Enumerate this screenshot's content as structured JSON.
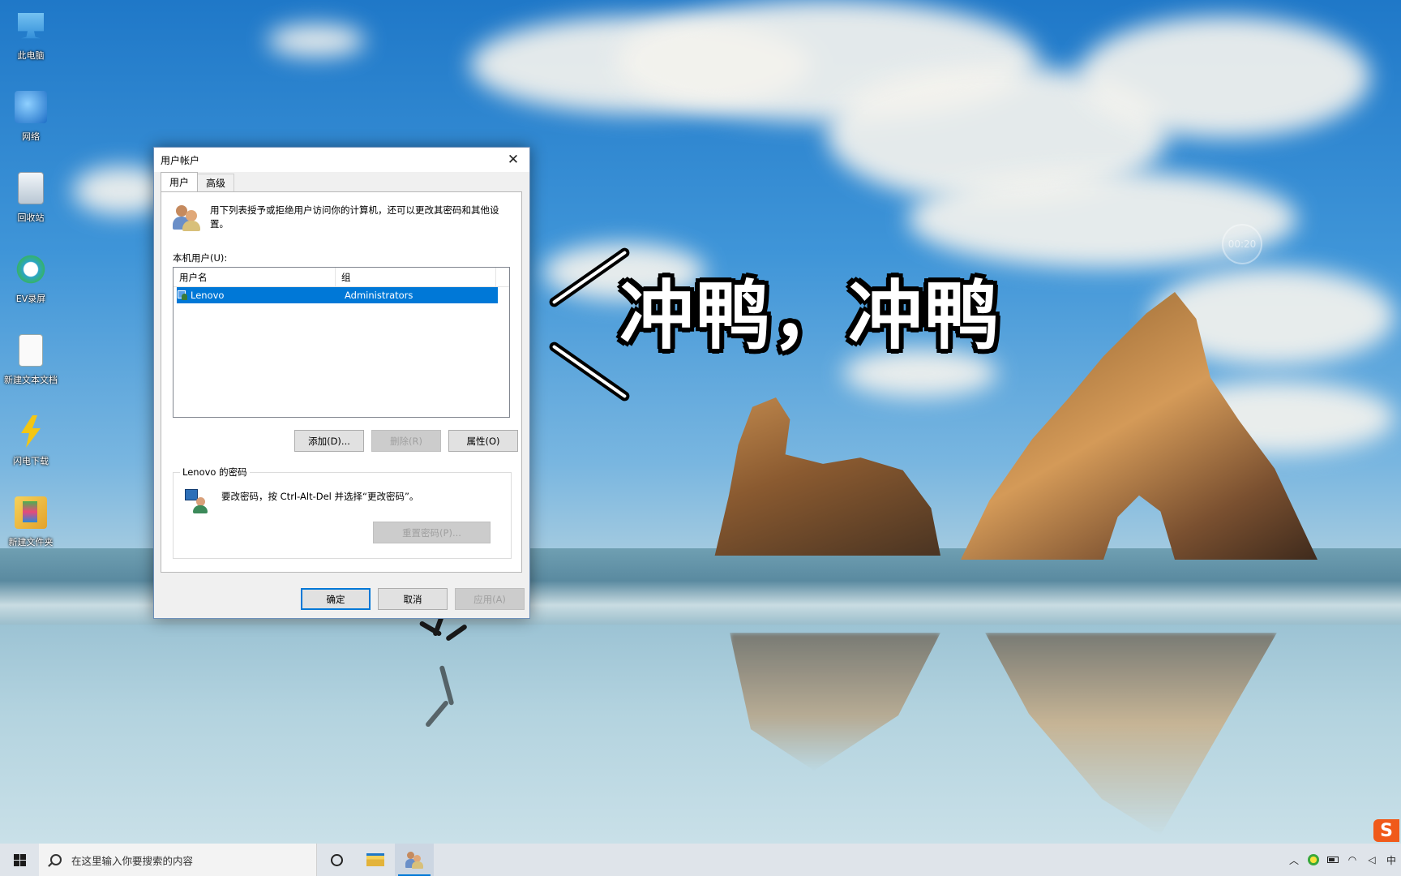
{
  "desktop": {
    "icons": [
      {
        "label": "此电脑",
        "icon": "computer-icon"
      },
      {
        "label": "网络",
        "icon": "network-icon"
      },
      {
        "label": "回收站",
        "icon": "recycle-bin-icon"
      },
      {
        "label": "EV录屏",
        "icon": "ev-recorder-icon"
      },
      {
        "label": "新建文本文档",
        "icon": "text-document-icon"
      },
      {
        "label": "闪电下载",
        "icon": "lightning-download-icon"
      },
      {
        "label": "新建文件夹",
        "icon": "folder-icon"
      }
    ]
  },
  "overlay": {
    "caption": "冲鸭，冲鸭",
    "timer": "00:20",
    "watermark": "S"
  },
  "dialog": {
    "title": "用户帐户",
    "tabs": [
      {
        "label": "用户",
        "active": true
      },
      {
        "label": "高级",
        "active": false
      }
    ],
    "intro_text": "用下列表授予或拒绝用户访问你的计算机，还可以更改其密码和其他设置。",
    "local_users_label": "本机用户(U):",
    "table": {
      "columns": [
        "用户名",
        "组"
      ],
      "rows": [
        {
          "name": "Lenovo",
          "group": "Administrators",
          "selected": true
        }
      ]
    },
    "buttons": {
      "add": "添加(D)...",
      "remove": "删除(R)",
      "properties": "属性(O)"
    },
    "password_group": {
      "legend": "Lenovo 的密码",
      "text": "要改密码，按 Ctrl-Alt-Del 并选择“更改密码”。",
      "reset_button": "重置密码(P)..."
    },
    "footer": {
      "ok": "确定",
      "cancel": "取消",
      "apply": "应用(A)"
    }
  },
  "taskbar": {
    "search_placeholder": "在这里输入你要搜索的内容",
    "accent": "#0078d7"
  }
}
